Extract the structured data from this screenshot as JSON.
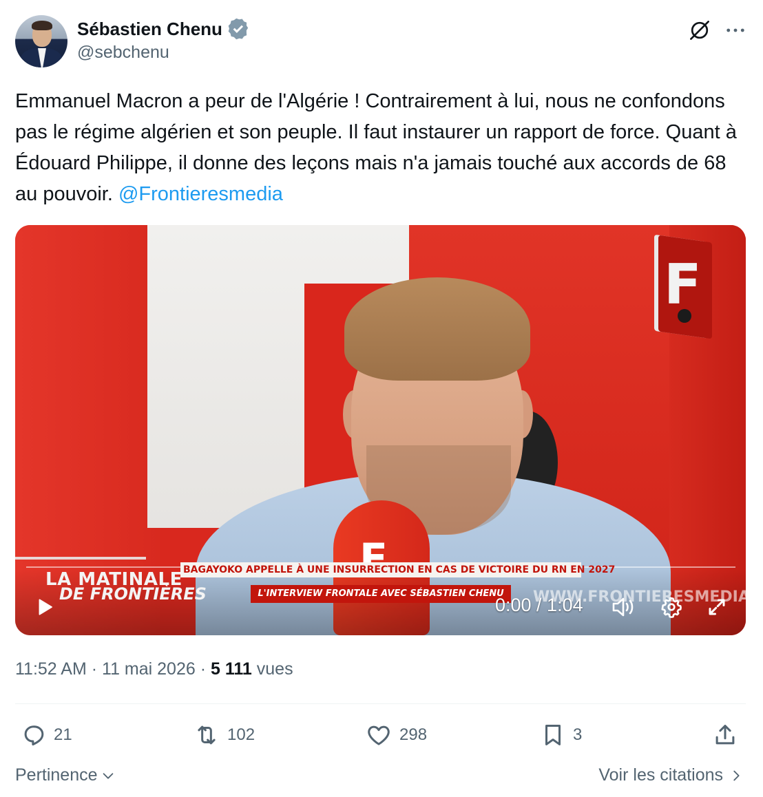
{
  "author": {
    "display_name": "Sébastien Chenu",
    "handle": "@sebchenu",
    "verified": true
  },
  "tweet": {
    "text": "Emmanuel Macron a peur de l'Algérie ! Contrairement à lui, nous ne confondons pas le régime algérien et son peuple. Il faut instaurer un rapport de force. Quant à Édouard Philippe, il donne des leçons mais n'a jamais touché aux accords de 68 au pouvoir. ",
    "mention": "@Frontieresmedia"
  },
  "video": {
    "headline": "BAGAYOKO APPELLE À UNE INSURRECTION EN CAS DE VICTOIRE DU RN EN 2027",
    "subheadline": "L'INTERVIEW FRONTALE AVEC SÉBASTIEN CHENU",
    "brand_line1": "LA MATINALE",
    "brand_line2": "DE FRONTIÈRES",
    "site_url": "WWW.FRONTIERESMEDIA.FR",
    "logo_letter": "F",
    "mic_letter": "F",
    "time": "0:00 / 1:04"
  },
  "meta": {
    "time": "11:52 AM",
    "date": "11 mai 2026",
    "separator": "·",
    "views_count": "5 111",
    "views_label": "vues"
  },
  "actions": {
    "replies": "21",
    "reposts": "102",
    "likes": "298",
    "bookmarks": "3"
  },
  "footer": {
    "sort_label": "Pertinence",
    "quotes_label": "Voir les citations"
  },
  "colors": {
    "link": "#1d9bf0",
    "secondary_text": "#536471",
    "primary_text": "#0f1419",
    "verified_badge": "#829aab",
    "video_red": "#d9281e"
  },
  "icons": [
    "verified-badge-icon",
    "grok-icon",
    "more-icon",
    "play-icon",
    "volume-icon",
    "gear-icon",
    "fullscreen-icon",
    "reply-icon",
    "repost-icon",
    "like-icon",
    "bookmark-icon",
    "share-icon",
    "chevron-down-icon",
    "chevron-right-icon"
  ]
}
